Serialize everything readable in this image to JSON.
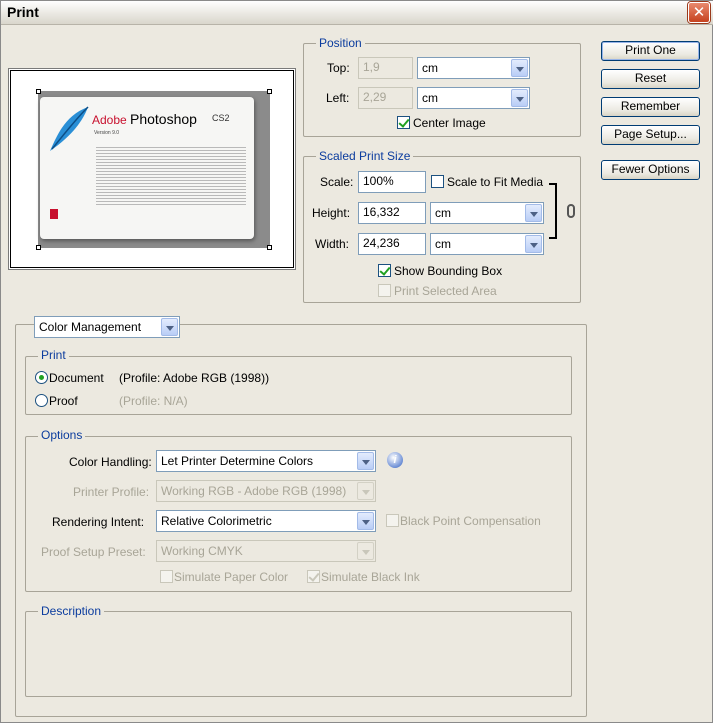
{
  "window": {
    "title": "Print",
    "close_glyph": "✕"
  },
  "buttons": {
    "print_one": "Print One",
    "reset": "Reset",
    "remember": "Remember",
    "page_setup": "Page Setup...",
    "fewer_options": "Fewer Options"
  },
  "preview": {
    "brand": "Adobe",
    "product": "Photoshop",
    "edition": "CS2",
    "version": "Version 9.0",
    "icon": "feather-icon"
  },
  "position": {
    "legend": "Position",
    "top_label": "Top:",
    "top_value": "1,9",
    "top_unit": "cm",
    "left_label": "Left:",
    "left_value": "2,29",
    "left_unit": "cm",
    "center_image_label": "Center Image",
    "center_image_checked": true
  },
  "scaled": {
    "legend": "Scaled Print Size",
    "scale_label": "Scale:",
    "scale_value": "100%",
    "scale_to_fit_label": "Scale to Fit Media",
    "scale_to_fit_checked": false,
    "height_label": "Height:",
    "height_value": "16,332",
    "height_unit": "cm",
    "width_label": "Width:",
    "width_value": "24,236",
    "width_unit": "cm",
    "show_bounding_box_label": "Show Bounding Box",
    "show_bounding_box_checked": true,
    "print_selected_area_label": "Print Selected Area",
    "print_selected_area_checked": false
  },
  "color_mgmt": {
    "dropdown_value": "Color Management",
    "print_group": {
      "legend": "Print",
      "document_label": "Document",
      "document_profile": "(Profile: Adobe RGB (1998))",
      "proof_label": "Proof",
      "proof_profile": "(Profile: N/A)",
      "selected": "document"
    },
    "options_group": {
      "legend": "Options",
      "color_handling_label": "Color Handling:",
      "color_handling_value": "Let Printer Determine Colors",
      "printer_profile_label": "Printer Profile:",
      "printer_profile_value": "Working RGB - Adobe RGB (1998)",
      "rendering_intent_label": "Rendering Intent:",
      "rendering_intent_value": "Relative Colorimetric",
      "black_point_label": "Black Point Compensation",
      "proof_setup_label": "Proof Setup Preset:",
      "proof_setup_value": "Working CMYK",
      "simulate_paper_label": "Simulate Paper Color",
      "simulate_black_label": "Simulate Black Ink",
      "info_glyph": "i"
    },
    "description_group": {
      "legend": "Description"
    }
  }
}
